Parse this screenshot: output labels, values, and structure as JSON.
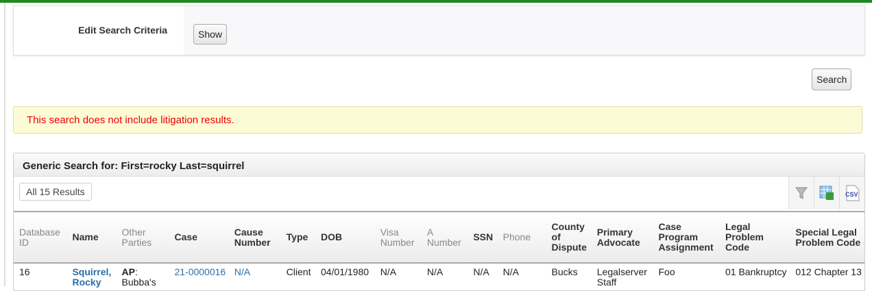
{
  "criteria": {
    "label": "Edit Search Criteria",
    "show_label": "Show"
  },
  "search_label": "Search",
  "notice": "This search does not include litigation results.",
  "results": {
    "title": "Generic Search for: First=rocky Last=squirrel",
    "all_results": "All 15 Results",
    "icons": [
      "filter-icon",
      "excel-export-icon",
      "csv-export-icon"
    ],
    "csv": "CSV"
  },
  "columns": [
    "Database ID",
    "Name",
    "Other Parties",
    "Case",
    "Cause Number",
    "Type",
    "DOB",
    "Visa Number",
    "A Number",
    "SSN",
    "Phone",
    "County of Dispute",
    "Primary Advocate",
    "Case Program Assignment",
    "Legal Problem Code",
    "Special Legal Problem Code"
  ],
  "row": {
    "id": "16",
    "name_last": "Squirrel",
    "name_first": "Rocky",
    "other_label": "AP",
    "other_value": "Bubba's",
    "case": "21-0000016",
    "cause": "N/A",
    "type": "Client",
    "dob": "04/01/1980",
    "visa": "N/A",
    "anum": "N/A",
    "ssn": "N/A",
    "phone": "N/A",
    "county": "Bucks",
    "advocate": "Legalserver Staff",
    "program": "Foo",
    "lpc": "01 Bankruptcy",
    "slpc": "012 Chapter 13"
  }
}
